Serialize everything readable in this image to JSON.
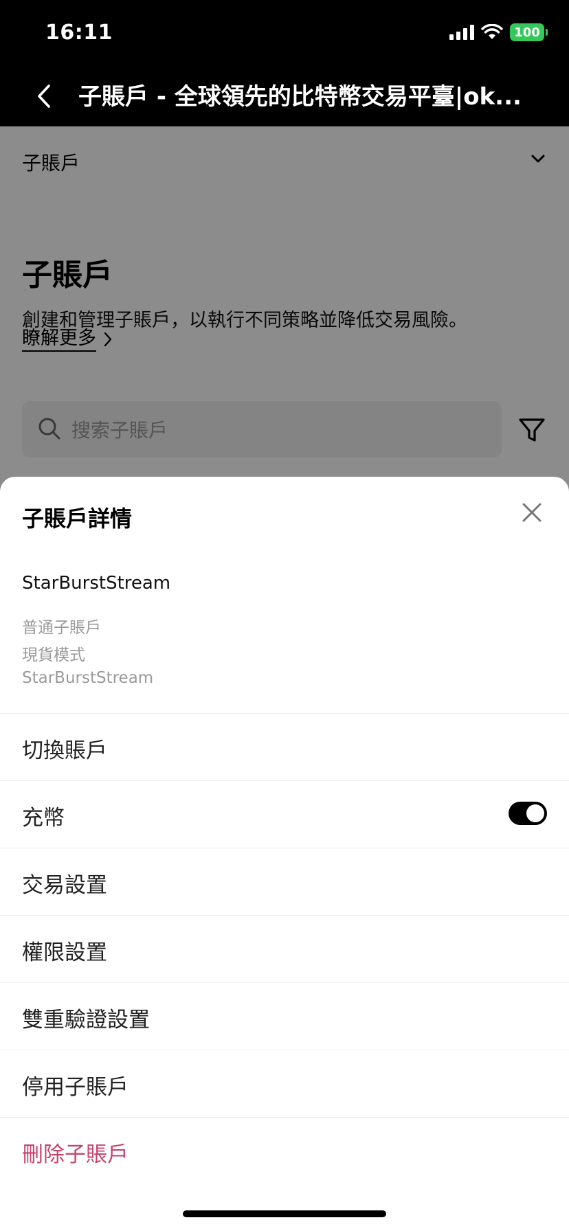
{
  "status_bar": {
    "time": "16:11",
    "battery": "100",
    "colors": {
      "battery": "#34c759"
    }
  },
  "nav": {
    "title": "子賬戶 - 全球領先的比特幣交易平臺|ok..."
  },
  "page": {
    "dropdown_label": "子賬戶",
    "heading": "子賬戶",
    "description": "創建和管理子賬戶，以執行不同策略並降低交易風險。",
    "learn_more": "瞭解更多",
    "search": {
      "placeholder": "搜索子賬戶"
    }
  },
  "sheet": {
    "title": "子賬戶詳情",
    "account": {
      "name": "StarBurstStream",
      "type": "普通子賬戶",
      "mode": "現貨模式",
      "label": "StarBurstStream"
    },
    "menu": {
      "switch_account": "切換賬戶",
      "deposit": "充幣",
      "deposit_enabled": true,
      "trade_settings": "交易設置",
      "permission_settings": "權限設置",
      "two_factor_settings": "雙重驗證設置",
      "disable_account": "停用子賬戶",
      "delete_account": "刪除子賬戶"
    },
    "colors": {
      "danger": "#c8426b",
      "toggle_on": "#000000"
    }
  }
}
